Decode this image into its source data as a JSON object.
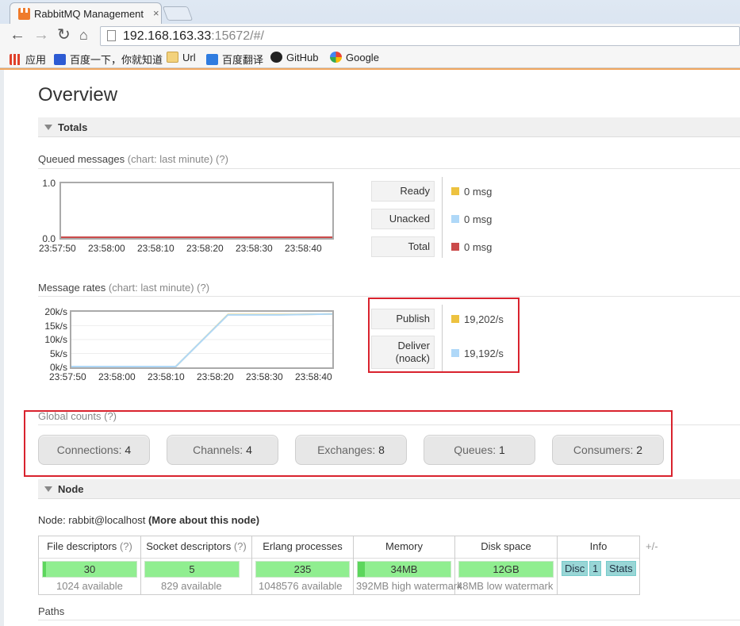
{
  "browser": {
    "tab_title": "RabbitMQ Management",
    "tab_close": "×",
    "url_host": "192.168.163.33",
    "url_rest": ":15672/#/",
    "bookmarks": [
      {
        "label": "应用",
        "icon": "apps-grid-icon",
        "color": "#e0402a"
      },
      {
        "label": "百度一下，你就知道",
        "icon": "baidu-paw-icon",
        "color": "#2d5bd3"
      },
      {
        "label": "Url",
        "icon": "folder-icon",
        "color": "#e6b64c"
      },
      {
        "label": "百度翻译",
        "icon": "translate-icon",
        "color": "#2f7ce0"
      },
      {
        "label": "GitHub",
        "icon": "github-icon",
        "color": "#222222"
      },
      {
        "label": "Google",
        "icon": "google-g-icon",
        "color": "#4285f4"
      }
    ]
  },
  "overview": {
    "title": "Overview",
    "totals_label": "Totals",
    "queued": {
      "title": "Queued messages",
      "chart_note": "(chart: last minute) (?)",
      "legend": [
        {
          "label": "Ready",
          "value": "0 msg",
          "color": "#edc240"
        },
        {
          "label": "Unacked",
          "value": "0 msg",
          "color": "#afd8f8"
        },
        {
          "label": "Total",
          "value": "0 msg",
          "color": "#cb4b4b"
        }
      ]
    },
    "rates": {
      "title": "Message rates",
      "chart_note": "(chart: last minute) (?)",
      "legend": [
        {
          "label": "Publish",
          "value": "19,202/s",
          "color": "#edc240"
        },
        {
          "label_line1": "Deliver",
          "label_line2": "(noack)",
          "value": "19,192/s",
          "color": "#afd8f8"
        }
      ]
    },
    "global_counts": {
      "title": "Global counts",
      "help": "(?)",
      "items": [
        {
          "label": "Connections:",
          "value": "4"
        },
        {
          "label": "Channels:",
          "value": "4"
        },
        {
          "label": "Exchanges:",
          "value": "8"
        },
        {
          "label": "Queues:",
          "value": "1"
        },
        {
          "label": "Consumers:",
          "value": "2"
        }
      ]
    },
    "node_section": {
      "label": "Node",
      "node_prefix": "Node: rabbit@localhost",
      "node_link": "(More about this node)",
      "columns": [
        {
          "head": "File descriptors",
          "help": "(?)",
          "value": "30",
          "sub": "1024 available",
          "fill": 0.029
        },
        {
          "head": "Socket descriptors",
          "help": "(?)",
          "value": "5",
          "sub": "829 available",
          "fill": 0.006
        },
        {
          "head": "Erlang processes",
          "help": "",
          "value": "235",
          "sub": "1048576 available",
          "fill": 0.0002
        },
        {
          "head": "Memory",
          "help": "",
          "value": "34MB",
          "sub": "392MB high watermark",
          "fill": 0.087
        },
        {
          "head": "Disk space",
          "help": "",
          "value": "12GB",
          "sub": "48MB low watermark",
          "fill": 1.0
        }
      ],
      "info_head": "Info",
      "info_chips": [
        "Disc",
        "1",
        "Stats"
      ],
      "plus_minus": "+/-"
    },
    "paths_label": "Paths"
  },
  "chart_data": [
    {
      "type": "line",
      "title": "Queued messages",
      "x": [
        "23:57:50",
        "23:58:00",
        "23:58:10",
        "23:58:20",
        "23:58:30",
        "23:58:40"
      ],
      "ylim": [
        0,
        1.0
      ],
      "yticks": [
        "1.0",
        "0.0"
      ],
      "series": [
        {
          "name": "Ready",
          "values": [
            0,
            0,
            0,
            0,
            0,
            0
          ]
        },
        {
          "name": "Unacked",
          "values": [
            0,
            0,
            0,
            0,
            0,
            0
          ]
        },
        {
          "name": "Total",
          "values": [
            0,
            0,
            0,
            0,
            0,
            0
          ]
        }
      ]
    },
    {
      "type": "line",
      "title": "Message rates",
      "x": [
        "23:57:50",
        "23:58:00",
        "23:58:10",
        "23:58:20",
        "23:58:30",
        "23:58:40"
      ],
      "ylim": [
        0,
        20000
      ],
      "yticks": [
        "20k/s",
        "15k/s",
        "10k/s",
        "5k/s",
        "0k/s"
      ],
      "series": [
        {
          "name": "Publish",
          "values": [
            0,
            0,
            0,
            19000,
            19000,
            19200
          ]
        },
        {
          "name": "Deliver (noack)",
          "values": [
            0,
            0,
            0,
            18900,
            18900,
            19200
          ]
        }
      ]
    }
  ]
}
